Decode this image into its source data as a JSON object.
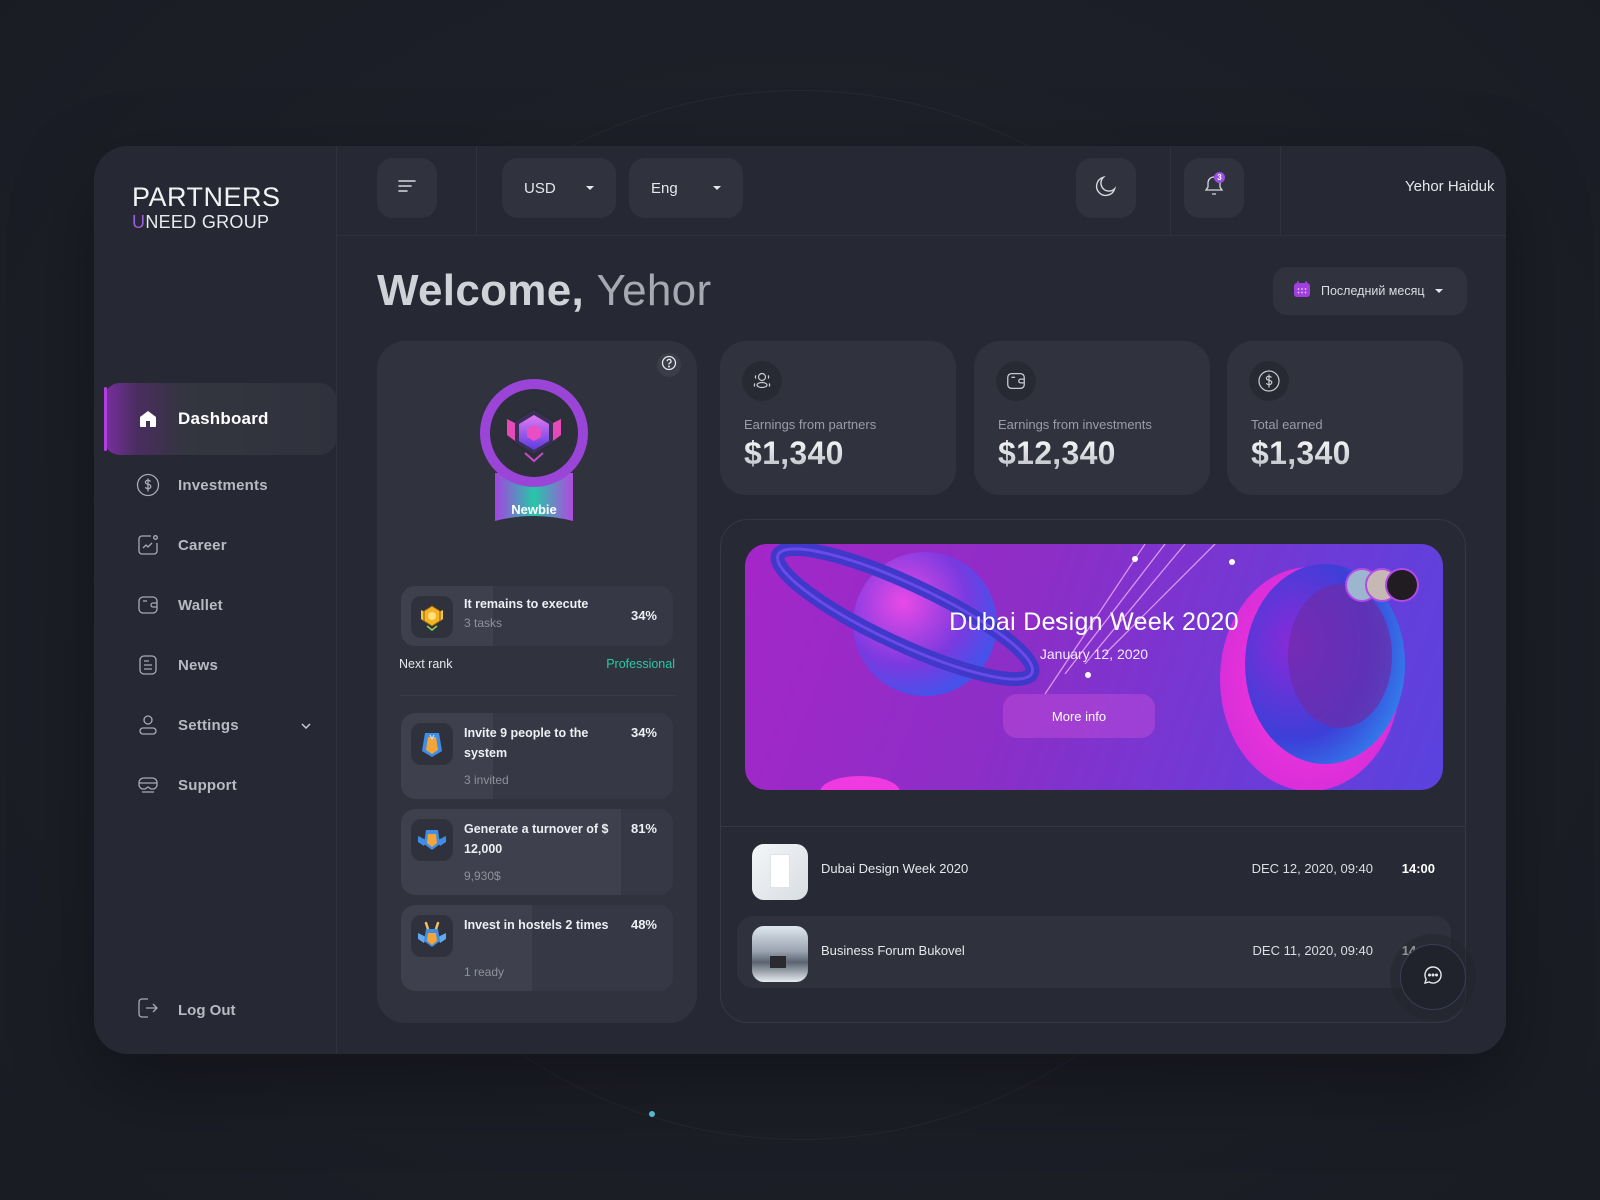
{
  "brand": {
    "line1": "PARTNERS",
    "line2_accent": "U",
    "line2": "NEED GROUP"
  },
  "sidebar": {
    "items": [
      {
        "label": "Dashboard",
        "icon": "home-icon",
        "active": true
      },
      {
        "label": "Investments",
        "icon": "dollar-circle-icon"
      },
      {
        "label": "Career",
        "icon": "chart-card-icon"
      },
      {
        "label": "Wallet",
        "icon": "wallet-icon"
      },
      {
        "label": "News",
        "icon": "document-icon"
      },
      {
        "label": "Settings",
        "icon": "user-icon",
        "has_submenu": true
      },
      {
        "label": "Support",
        "icon": "vr-headset-icon"
      }
    ],
    "logout_label": "Log Out"
  },
  "header": {
    "currency": "USD",
    "language": "Eng",
    "notifications_count": "3",
    "user_name": "Yehor Haiduk"
  },
  "welcome": {
    "greeting": "Welcome,",
    "name": "Yehor"
  },
  "period_filter": {
    "selected": "Последний месяц"
  },
  "rank": {
    "current": "Newbie",
    "remaining": {
      "title": "It remains to execute",
      "subtitle": "3 tasks",
      "percent": "34%",
      "progress": 0.34
    },
    "next_rank_label": "Next rank",
    "next_rank_value": "Professional",
    "tasks": [
      {
        "title": "Invite 9 people to the system",
        "subtitle": "3 invited",
        "percent": "34%",
        "progress": 0.34
      },
      {
        "title": "Generate a turnover of $ 12,000",
        "subtitle": "9,930$",
        "percent": "81%",
        "progress": 0.81
      },
      {
        "title": "Invest in hostels 2 times",
        "subtitle": "1 ready",
        "percent": "48%",
        "progress": 0.48
      }
    ]
  },
  "stats": [
    {
      "label": "Earnings from partners",
      "value": "$1,340",
      "icon": "partners-icon"
    },
    {
      "label": "Earnings from investments",
      "value": "$12,340",
      "icon": "wallet-icon"
    },
    {
      "label": "Total earned",
      "value": "$1,340",
      "icon": "dollar-circle-icon"
    }
  ],
  "featured_event": {
    "title": "Dubai Design Week 2020",
    "date": "January 12, 2020",
    "cta": "More info",
    "attendee_count": 3
  },
  "events": [
    {
      "name": "Dubai Design Week 2020",
      "date": "DEC 12, 2020, 09:40",
      "time": "14:00"
    },
    {
      "name": "Business Forum Bukovel",
      "date": "DEC 11, 2020, 09:40",
      "time": "14:00"
    }
  ],
  "colors": {
    "accent": "#9b4fe6",
    "next_rank": "#29c9a8",
    "background": "#1d1f28",
    "panel": "#262933",
    "card": "#30333d"
  }
}
